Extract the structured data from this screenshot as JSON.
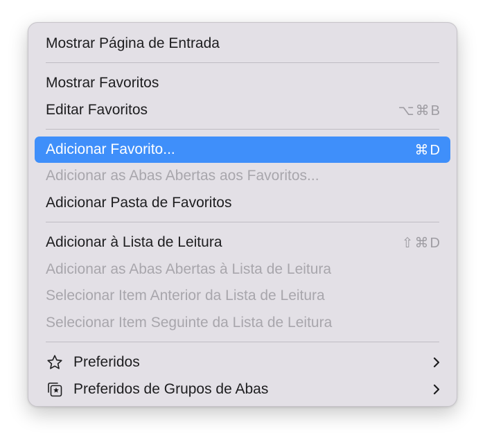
{
  "menu": {
    "show_start_page": "Mostrar Página de Entrada",
    "show_favorites": "Mostrar Favoritos",
    "edit_favorites": "Editar Favoritos",
    "edit_favorites_shortcut": "⌥⌘B",
    "add_favorite": "Adicionar Favorito...",
    "add_favorite_shortcut": "⌘D",
    "add_open_tabs_favorites": "Adicionar as Abas Abertas aos Favoritos...",
    "add_favorites_folder": "Adicionar Pasta de Favoritos",
    "add_reading_list": "Adicionar à Lista de Leitura",
    "add_reading_list_shortcut": "⇧⌘D",
    "add_open_tabs_reading_list": "Adicionar as Abas Abertas à Lista de Leitura",
    "select_previous_item": "Selecionar Item Anterior da Lista de Leitura",
    "select_next_item": "Selecionar Item Seguinte da Lista de Leitura",
    "preferred": "Preferidos",
    "preferred_tab_groups": "Preferidos de Grupos de Abas"
  },
  "icons": {
    "preferred": "star-icon",
    "preferred_tab_groups": "tab-group-star-icon",
    "submenu": "chevron-right-icon"
  },
  "colors": {
    "menu_background": "#e3e0e6",
    "highlight": "#3f8ffa",
    "text": "#1d1d1f",
    "disabled_text": "#a8a6ac",
    "shortcut_text": "#9e9ca2"
  }
}
